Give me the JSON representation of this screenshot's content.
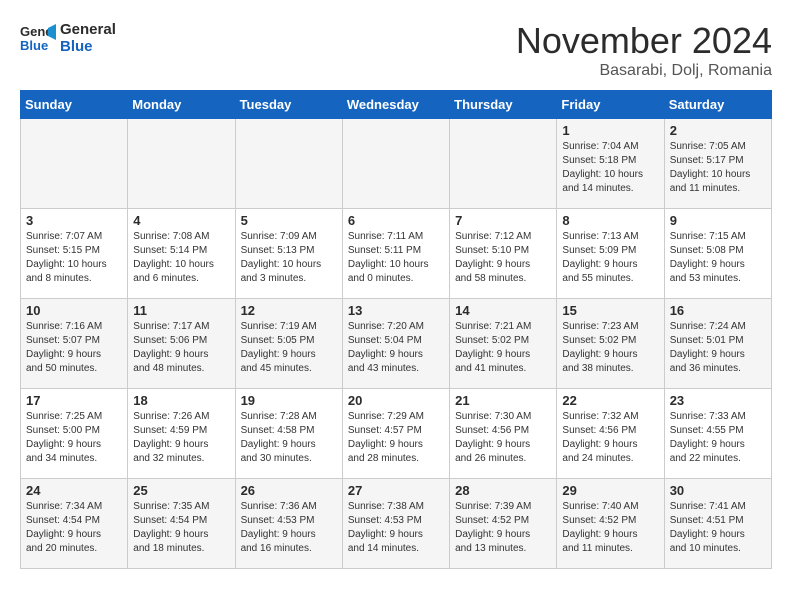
{
  "header": {
    "logo_line1": "General",
    "logo_line2": "Blue",
    "month_title": "November 2024",
    "location": "Basarabi, Dolj, Romania"
  },
  "weekdays": [
    "Sunday",
    "Monday",
    "Tuesday",
    "Wednesday",
    "Thursday",
    "Friday",
    "Saturday"
  ],
  "weeks": [
    [
      {
        "day": "",
        "info": ""
      },
      {
        "day": "",
        "info": ""
      },
      {
        "day": "",
        "info": ""
      },
      {
        "day": "",
        "info": ""
      },
      {
        "day": "",
        "info": ""
      },
      {
        "day": "1",
        "info": "Sunrise: 7:04 AM\nSunset: 5:18 PM\nDaylight: 10 hours\nand 14 minutes."
      },
      {
        "day": "2",
        "info": "Sunrise: 7:05 AM\nSunset: 5:17 PM\nDaylight: 10 hours\nand 11 minutes."
      }
    ],
    [
      {
        "day": "3",
        "info": "Sunrise: 7:07 AM\nSunset: 5:15 PM\nDaylight: 10 hours\nand 8 minutes."
      },
      {
        "day": "4",
        "info": "Sunrise: 7:08 AM\nSunset: 5:14 PM\nDaylight: 10 hours\nand 6 minutes."
      },
      {
        "day": "5",
        "info": "Sunrise: 7:09 AM\nSunset: 5:13 PM\nDaylight: 10 hours\nand 3 minutes."
      },
      {
        "day": "6",
        "info": "Sunrise: 7:11 AM\nSunset: 5:11 PM\nDaylight: 10 hours\nand 0 minutes."
      },
      {
        "day": "7",
        "info": "Sunrise: 7:12 AM\nSunset: 5:10 PM\nDaylight: 9 hours\nand 58 minutes."
      },
      {
        "day": "8",
        "info": "Sunrise: 7:13 AM\nSunset: 5:09 PM\nDaylight: 9 hours\nand 55 minutes."
      },
      {
        "day": "9",
        "info": "Sunrise: 7:15 AM\nSunset: 5:08 PM\nDaylight: 9 hours\nand 53 minutes."
      }
    ],
    [
      {
        "day": "10",
        "info": "Sunrise: 7:16 AM\nSunset: 5:07 PM\nDaylight: 9 hours\nand 50 minutes."
      },
      {
        "day": "11",
        "info": "Sunrise: 7:17 AM\nSunset: 5:06 PM\nDaylight: 9 hours\nand 48 minutes."
      },
      {
        "day": "12",
        "info": "Sunrise: 7:19 AM\nSunset: 5:05 PM\nDaylight: 9 hours\nand 45 minutes."
      },
      {
        "day": "13",
        "info": "Sunrise: 7:20 AM\nSunset: 5:04 PM\nDaylight: 9 hours\nand 43 minutes."
      },
      {
        "day": "14",
        "info": "Sunrise: 7:21 AM\nSunset: 5:02 PM\nDaylight: 9 hours\nand 41 minutes."
      },
      {
        "day": "15",
        "info": "Sunrise: 7:23 AM\nSunset: 5:02 PM\nDaylight: 9 hours\nand 38 minutes."
      },
      {
        "day": "16",
        "info": "Sunrise: 7:24 AM\nSunset: 5:01 PM\nDaylight: 9 hours\nand 36 minutes."
      }
    ],
    [
      {
        "day": "17",
        "info": "Sunrise: 7:25 AM\nSunset: 5:00 PM\nDaylight: 9 hours\nand 34 minutes."
      },
      {
        "day": "18",
        "info": "Sunrise: 7:26 AM\nSunset: 4:59 PM\nDaylight: 9 hours\nand 32 minutes."
      },
      {
        "day": "19",
        "info": "Sunrise: 7:28 AM\nSunset: 4:58 PM\nDaylight: 9 hours\nand 30 minutes."
      },
      {
        "day": "20",
        "info": "Sunrise: 7:29 AM\nSunset: 4:57 PM\nDaylight: 9 hours\nand 28 minutes."
      },
      {
        "day": "21",
        "info": "Sunrise: 7:30 AM\nSunset: 4:56 PM\nDaylight: 9 hours\nand 26 minutes."
      },
      {
        "day": "22",
        "info": "Sunrise: 7:32 AM\nSunset: 4:56 PM\nDaylight: 9 hours\nand 24 minutes."
      },
      {
        "day": "23",
        "info": "Sunrise: 7:33 AM\nSunset: 4:55 PM\nDaylight: 9 hours\nand 22 minutes."
      }
    ],
    [
      {
        "day": "24",
        "info": "Sunrise: 7:34 AM\nSunset: 4:54 PM\nDaylight: 9 hours\nand 20 minutes."
      },
      {
        "day": "25",
        "info": "Sunrise: 7:35 AM\nSunset: 4:54 PM\nDaylight: 9 hours\nand 18 minutes."
      },
      {
        "day": "26",
        "info": "Sunrise: 7:36 AM\nSunset: 4:53 PM\nDaylight: 9 hours\nand 16 minutes."
      },
      {
        "day": "27",
        "info": "Sunrise: 7:38 AM\nSunset: 4:53 PM\nDaylight: 9 hours\nand 14 minutes."
      },
      {
        "day": "28",
        "info": "Sunrise: 7:39 AM\nSunset: 4:52 PM\nDaylight: 9 hours\nand 13 minutes."
      },
      {
        "day": "29",
        "info": "Sunrise: 7:40 AM\nSunset: 4:52 PM\nDaylight: 9 hours\nand 11 minutes."
      },
      {
        "day": "30",
        "info": "Sunrise: 7:41 AM\nSunset: 4:51 PM\nDaylight: 9 hours\nand 10 minutes."
      }
    ]
  ]
}
